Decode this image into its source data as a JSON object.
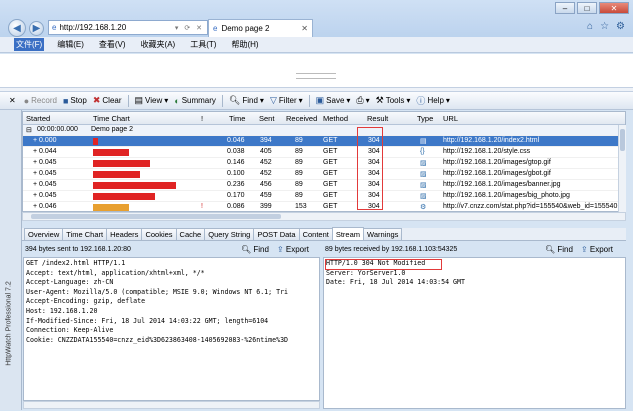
{
  "browser": {
    "address": "http://192.168.1.20",
    "tab_title": "Demo page 2",
    "window_min": "–",
    "window_max": "□",
    "window_close": "✕"
  },
  "menu": [
    "文件(F)",
    "编辑(E)",
    "查看(V)",
    "收藏夹(A)",
    "工具(T)",
    "帮助(H)"
  ],
  "toolbar": {
    "record": "Record",
    "stop": "Stop",
    "clear": "Clear",
    "view": "View",
    "summary": "Summary",
    "find": "Find",
    "filter": "Filter",
    "save": "Save",
    "tools": "Tools",
    "help": "Help"
  },
  "table": {
    "headers": [
      "Started",
      "Time Chart",
      "!",
      "Time",
      "Sent",
      "Received",
      "Method",
      "Result",
      "Type",
      "URL"
    ],
    "group": {
      "started": "00:00:00.000",
      "label": "Demo page 2"
    },
    "rows": [
      {
        "started": "+ 0.000",
        "warn": "",
        "time": "0.046",
        "sent": "394",
        "received": "89",
        "method": "GET",
        "result": "304",
        "type": "html",
        "url": "http://192.168.1.20/index2.html",
        "bar": 0.05
      },
      {
        "started": "+ 0.044",
        "warn": "",
        "time": "0.038",
        "sent": "405",
        "received": "89",
        "method": "GET",
        "result": "304",
        "type": "css",
        "url": "http://192.168.1.20/style.css",
        "bar": 0.35
      },
      {
        "started": "+ 0.045",
        "warn": "",
        "time": "0.146",
        "sent": "452",
        "received": "89",
        "method": "GET",
        "result": "304",
        "type": "img",
        "url": "http://192.168.1.20/images/gtop.gif",
        "bar": 0.55
      },
      {
        "started": "+ 0.045",
        "warn": "",
        "time": "0.100",
        "sent": "452",
        "received": "89",
        "method": "GET",
        "result": "304",
        "type": "img",
        "url": "http://192.168.1.20/images/gbot.gif",
        "bar": 0.45
      },
      {
        "started": "+ 0.045",
        "warn": "",
        "time": "0.236",
        "sent": "456",
        "received": "89",
        "method": "GET",
        "result": "304",
        "type": "img",
        "url": "http://192.168.1.20/images/banner.jpg",
        "bar": 0.8
      },
      {
        "started": "+ 0.045",
        "warn": "",
        "time": "0.170",
        "sent": "459",
        "received": "89",
        "method": "GET",
        "result": "304",
        "type": "img",
        "url": "http://192.168.1.20/images/big_photo.jpg",
        "bar": 0.6
      },
      {
        "started": "+ 0.046",
        "warn": "!",
        "time": "0.086",
        "sent": "399",
        "received": "153",
        "method": "GET",
        "result": "304",
        "type": "script",
        "url": "http://v7.cnzz.com/stat.php?id=155540&web_id=155540",
        "bar": 0.35
      }
    ]
  },
  "bottom_tabs": [
    "Overview",
    "Time Chart",
    "Headers",
    "Cookies",
    "Cache",
    "Query String",
    "POST Data",
    "Content",
    "Stream",
    "Warnings"
  ],
  "active_tab": "Stream",
  "left_pane": {
    "info": "394 bytes sent to 192.168.1.20:80",
    "find": "Find",
    "export": "Export",
    "content": "GET /index2.html HTTP/1.1\nAccept: text/html, application/xhtml+xml, */*\nAccept-Language: zh-CN\nUser-Agent: Mozilla/5.0 (compatible; MSIE 9.0; Windows NT 6.1; Tri\nAccept-Encoding: gzip, deflate\nHost: 192.168.1.20\nIf-Modified-Since: Fri, 18 Jul 2014 14:03:22 GMT; length=6104\nConnection: Keep-Alive\nCookie: CNZZDATA155540=cnzz_eid%3D623863408-1405692083-%26ntime%3D"
  },
  "right_pane": {
    "info": "89 bytes received by 192.168.1.103:54325",
    "find": "Find",
    "export": "Export",
    "content": "HTTP/1.0 304 Not Modified\nServer: YorServer1.0\nDate: Fri, 18 Jul 2014 14:03:54 GMT"
  },
  "vertical_label": "HttpWatch Professional 7.2",
  "colors": {
    "bar_red": "#e02424",
    "bar_orange": "#e8a030",
    "selected_row": "#3d78c8",
    "annotation": "#e23a3a"
  }
}
